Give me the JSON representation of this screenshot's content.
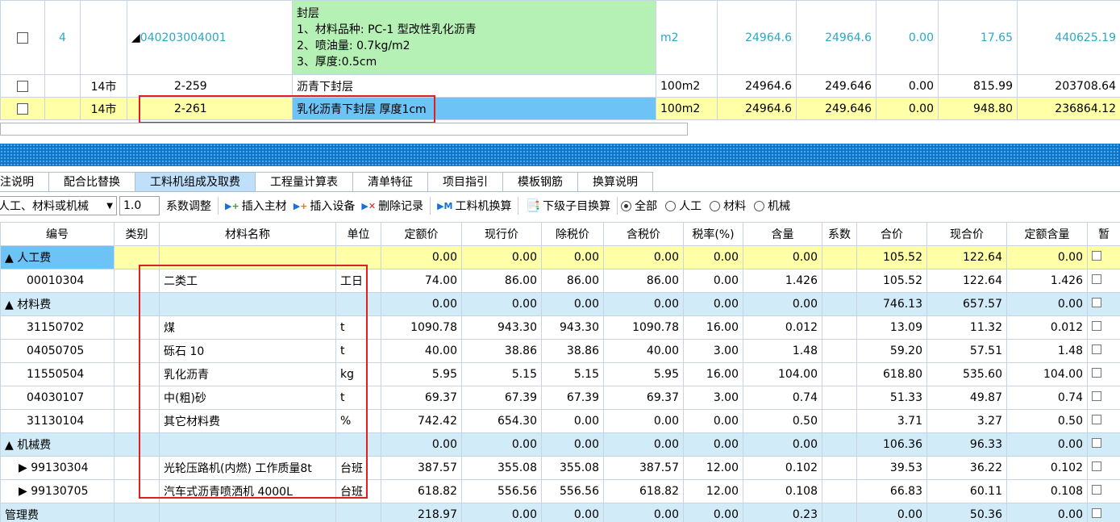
{
  "top": {
    "main_row": {
      "seq": "4",
      "code": "040203004001",
      "desc_lines": [
        "封层",
        "1、材料品种: PC-1 型改性乳化沥青",
        "2、喷油量: 0.7kg/m2",
        "3、厚度:0.5cm"
      ],
      "unit": "m2",
      "qty": "24964.6",
      "qty2": "24964.6",
      "v1": "0.00",
      "price": "17.65",
      "total": "440625.19"
    },
    "rows": [
      {
        "type": "14市",
        "code": "2-259",
        "name": "沥青下封层",
        "unit": "100m2",
        "qty": "24964.6",
        "qty2": "249.646",
        "v1": "0.00",
        "price": "815.99",
        "total": "203708.64"
      },
      {
        "type": "14市",
        "code": "2-261",
        "name": "乳化沥青下封层 厚度1cm",
        "unit": "100m2",
        "qty": "24964.6",
        "qty2": "249.646",
        "v1": "0.00",
        "price": "948.80",
        "total": "236864.12"
      }
    ]
  },
  "tabs": [
    "注说明",
    "配合比替换",
    "工料机组成及取费",
    "工程量计算表",
    "清单特征",
    "项目指引",
    "模板钢筋",
    "换算说明"
  ],
  "toolbar": {
    "select_value": "人工、材料或机械",
    "coef_value": "1.0",
    "coef_label": "系数调整",
    "insert_main": "插入主材",
    "insert_equip": "插入设备",
    "delete_record": "删除记录",
    "material_swap": "工料机换算",
    "sub_swap": "下级子目换算",
    "radios": [
      "全部",
      "人工",
      "材料",
      "机械"
    ]
  },
  "grid": {
    "headers": [
      "编号",
      "类别",
      "材料名称",
      "单位",
      "定额价",
      "现行价",
      "除税价",
      "含税价",
      "税率(%)",
      "含量",
      "系数",
      "合价",
      "现合价",
      "定额含量",
      "暂"
    ],
    "rows": [
      {
        "kind": "cat-labor",
        "code": "▲ 人工费",
        "type": "",
        "name": "",
        "unit": "",
        "v": [
          "0.00",
          "0.00",
          "0.00",
          "0.00",
          "0.00",
          "0.00",
          "",
          "105.52",
          "122.64",
          "0.00"
        ]
      },
      {
        "kind": "item",
        "code": "00010304",
        "type": "",
        "name": "二类工",
        "unit": "工日",
        "v": [
          "74.00",
          "86.00",
          "86.00",
          "86.00",
          "0.00",
          "1.426",
          "",
          "105.52",
          "122.64",
          "1.426"
        ]
      },
      {
        "kind": "cat",
        "code": "▲ 材料费",
        "type": "",
        "name": "",
        "unit": "",
        "v": [
          "0.00",
          "0.00",
          "0.00",
          "0.00",
          "0.00",
          "0.00",
          "",
          "746.13",
          "657.57",
          "0.00"
        ]
      },
      {
        "kind": "item",
        "code": "31150702",
        "type": "",
        "name": "煤",
        "unit": "t",
        "v": [
          "1090.78",
          "943.30",
          "943.30",
          "1090.78",
          "16.00",
          "0.012",
          "",
          "13.09",
          "11.32",
          "0.012"
        ]
      },
      {
        "kind": "item",
        "code": "04050705",
        "type": "",
        "name": "砾石  10",
        "unit": "t",
        "v": [
          "40.00",
          "38.86",
          "38.86",
          "40.00",
          "3.00",
          "1.48",
          "",
          "59.20",
          "57.51",
          "1.48"
        ]
      },
      {
        "kind": "item",
        "code": "11550504",
        "type": "",
        "name": "乳化沥青",
        "unit": "kg",
        "v": [
          "5.95",
          "5.15",
          "5.15",
          "5.95",
          "16.00",
          "104.00",
          "",
          "618.80",
          "535.60",
          "104.00"
        ]
      },
      {
        "kind": "item",
        "code": "04030107",
        "type": "",
        "name": "中(粗)砂",
        "unit": "t",
        "v": [
          "69.37",
          "67.39",
          "67.39",
          "69.37",
          "3.00",
          "0.74",
          "",
          "51.33",
          "49.87",
          "0.74"
        ]
      },
      {
        "kind": "item",
        "code": "31130104",
        "type": "",
        "name": "其它材料费",
        "unit": "%",
        "v": [
          "742.42",
          "654.30",
          "0.00",
          "0.00",
          "0.00",
          "0.50",
          "",
          "3.71",
          "3.27",
          "0.50"
        ]
      },
      {
        "kind": "cat",
        "code": "▲ 机械费",
        "type": "",
        "name": "",
        "unit": "",
        "v": [
          "0.00",
          "0.00",
          "0.00",
          "0.00",
          "0.00",
          "0.00",
          "",
          "106.36",
          "96.33",
          "0.00"
        ]
      },
      {
        "kind": "item",
        "code": "▶ 99130304",
        "type": "",
        "name": "光轮压路机(内燃) 工作质量8t",
        "unit": "台班",
        "v": [
          "387.57",
          "355.08",
          "355.08",
          "387.57",
          "12.00",
          "0.102",
          "",
          "39.53",
          "36.22",
          "0.102"
        ]
      },
      {
        "kind": "item",
        "code": "▶ 99130705",
        "type": "",
        "name": "汽车式沥青喷洒机 4000L",
        "unit": "台班",
        "v": [
          "618.82",
          "556.56",
          "556.56",
          "618.82",
          "12.00",
          "0.108",
          "",
          "66.83",
          "60.11",
          "0.108"
        ]
      },
      {
        "kind": "cat",
        "code": "管理费",
        "type": "",
        "name": "",
        "unit": "",
        "v": [
          "218.97",
          "0.00",
          "0.00",
          "0.00",
          "0.00",
          "0.23",
          "",
          "0.00",
          "50.36",
          "0.00"
        ]
      }
    ]
  }
}
